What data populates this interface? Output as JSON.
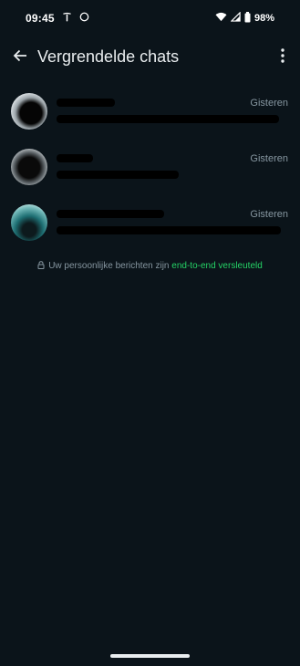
{
  "status_bar": {
    "time": "09:45",
    "battery": "98%",
    "icons": [
      "tesla-icon",
      "circle-icon",
      "wifi-icon",
      "signal-icon",
      "battery-icon"
    ]
  },
  "app_bar": {
    "title": "Vergrendelde chats",
    "back_icon": "arrow-left-icon",
    "menu_icon": "more-vertical-icon"
  },
  "chats": [
    {
      "name": "",
      "message": "",
      "time": "Gisteren"
    },
    {
      "name": "",
      "message": "",
      "time": "Gisteren"
    },
    {
      "name": "",
      "message": "",
      "time": "Gisteren"
    }
  ],
  "encryption": {
    "text": "Uw persoonlijke berichten zijn ",
    "link": "end-to-end versleuteld"
  },
  "colors": {
    "background": "#0b141a",
    "accent": "#25d366",
    "secondary_text": "#8696a0"
  }
}
